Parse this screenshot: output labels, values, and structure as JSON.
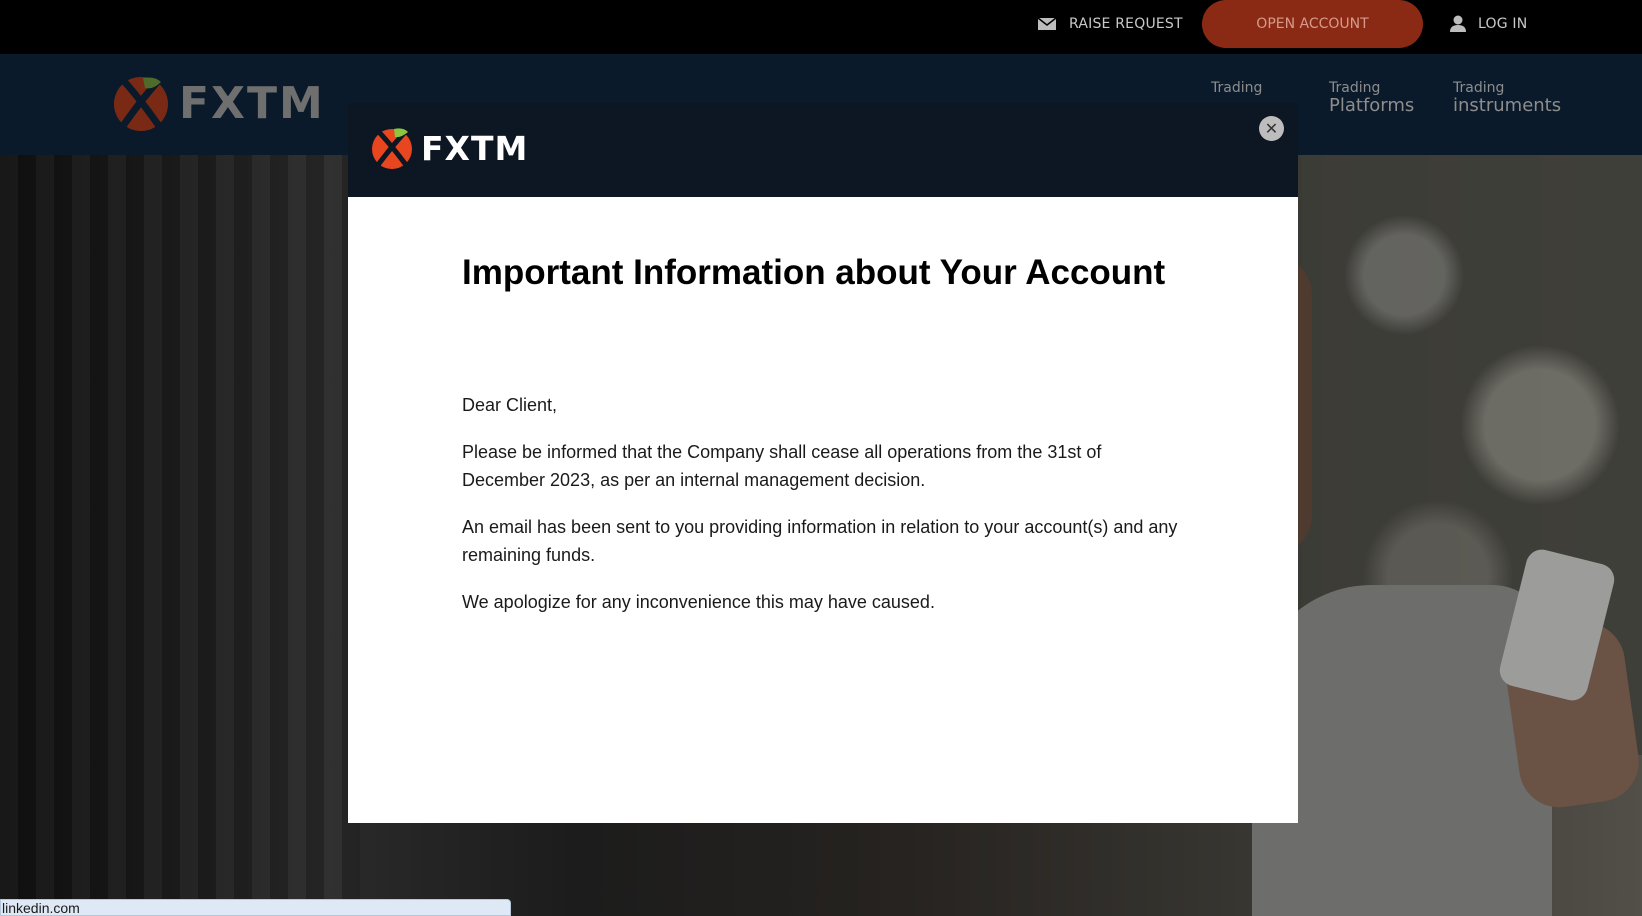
{
  "topbar": {
    "raise_request": "RAISE REQUEST",
    "open_account": "OPEN ACCOUNT",
    "log_in": "LOG IN"
  },
  "nav": {
    "logo": "FXTM",
    "links": [
      {
        "small": "Trading",
        "big": ""
      },
      {
        "small": "Trading",
        "big": "Platforms"
      },
      {
        "small": "Trading",
        "big": "instruments"
      }
    ]
  },
  "modal": {
    "logo": "FXTM",
    "close_symbol": "✕",
    "title": "Important Information about Your Account",
    "greeting": "Dear Client,",
    "paragraphs": [
      "Please be informed that the Company shall cease all operations from the 31st of December 2023, as per an internal management decision.",
      "An email has been sent to you providing information in relation to your account(s) and any remaining funds.",
      "We apologize for any inconvenience this may have caused."
    ]
  },
  "statusbar": {
    "url": "linkedin.com"
  },
  "colors": {
    "accent": "#8a2a14",
    "nav_background": "#0a1a2a",
    "modal_header": "#0d1623",
    "logo_orange": "#e8461e",
    "logo_green": "#8cc63f"
  },
  "icons": {
    "raise_request": "envelope-icon",
    "log_in": "user-icon",
    "close": "close-icon"
  }
}
